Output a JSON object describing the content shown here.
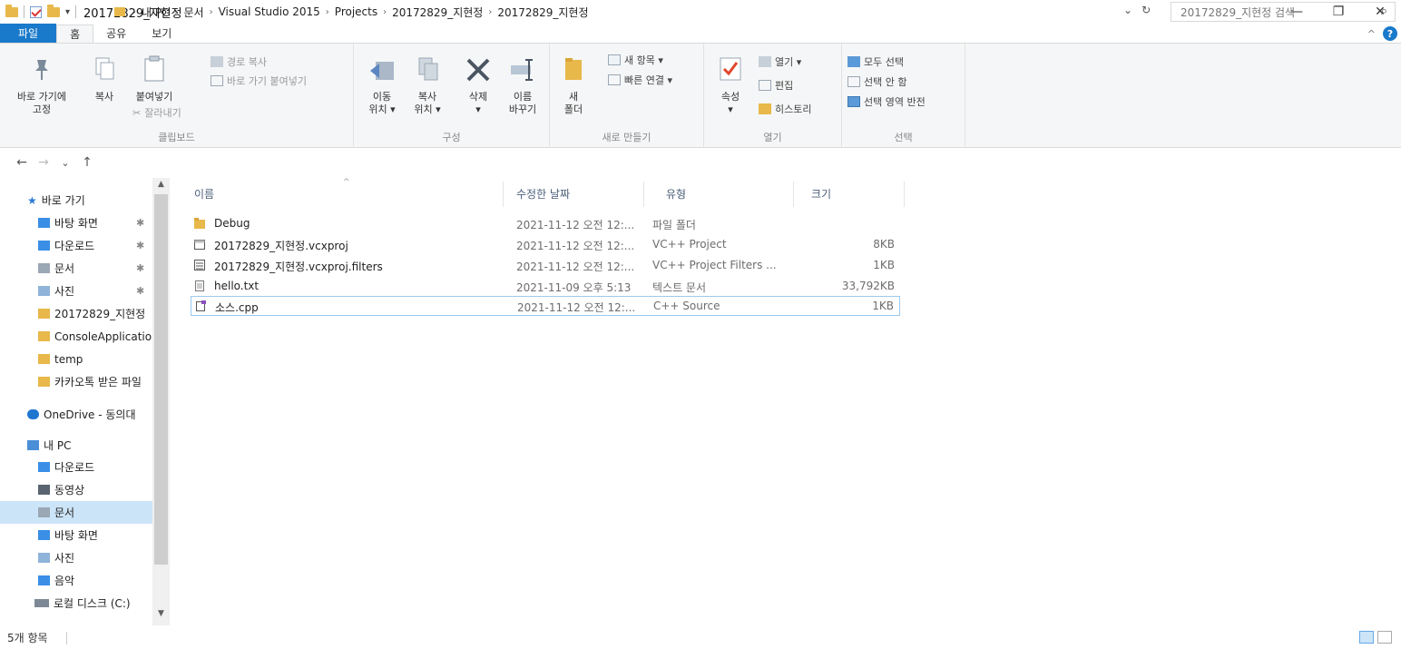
{
  "window": {
    "title": "20172829_지현정",
    "minimize": "—",
    "restore": "❐",
    "close": "✕"
  },
  "ribbon_tabs": {
    "file": "파일",
    "home": "홈",
    "share": "공유",
    "view": "보기",
    "collapse": "^",
    "help": "?"
  },
  "ribbon": {
    "clipboard": {
      "pin_label_1": "바로 가기에",
      "pin_label_2": "고정",
      "copy": "복사",
      "paste": "붙여넣기",
      "copy_path": "경로 복사",
      "paste_shortcut": "바로 가기 붙여넣기",
      "cut": "잘라내기",
      "group": "클립보드"
    },
    "organize": {
      "move_1": "이동",
      "move_2": "위치 ▾",
      "copyto_1": "복사",
      "copyto_2": "위치 ▾",
      "delete": "삭제",
      "delete_caret": "▾",
      "rename_1": "이름",
      "rename_2": "바꾸기",
      "group": "구성"
    },
    "new": {
      "new_folder_1": "새",
      "new_folder_2": "폴더",
      "new_item": "새 항목 ▾",
      "easy_access": "빠른 연결 ▾",
      "group": "새로 만들기"
    },
    "open": {
      "properties": "속성",
      "properties_caret": "▾",
      "open": "열기 ▾",
      "edit": "편집",
      "history": "히스토리",
      "group": "열기"
    },
    "select": {
      "select_all": "모두 선택",
      "select_none": "선택 안 함",
      "invert": "선택 영역 반전",
      "group": "선택"
    }
  },
  "address": {
    "back": "←",
    "forward": "→",
    "recent": "⌄",
    "up": "↑",
    "crumbs": [
      "내 PC",
      "문서",
      "Visual Studio 2015",
      "Projects",
      "20172829_지현정",
      "20172829_지현정"
    ],
    "sep": "›",
    "lead_sep": "›",
    "dropdown": "⌄",
    "refresh": "↻",
    "search_placeholder": "20172829_지현정 검색",
    "search_icon": "⌕"
  },
  "nav_pane": {
    "quick_access": "바로 가기",
    "pin": "✱",
    "items": [
      {
        "label": "바탕 화면",
        "pinned": true
      },
      {
        "label": "다운로드",
        "pinned": true
      },
      {
        "label": "문서",
        "pinned": true
      },
      {
        "label": "사진",
        "pinned": true
      },
      {
        "label": "20172829_지현정",
        "pinned": false
      },
      {
        "label": "ConsoleApplication",
        "pinned": false
      },
      {
        "label": "temp",
        "pinned": false
      },
      {
        "label": "카카오톡 받은 파일",
        "pinned": false
      }
    ],
    "onedrive": "OneDrive - 동의대",
    "this_pc": "내 PC",
    "pc_items": [
      "다운로드",
      "동영상",
      "문서",
      "바탕 화면",
      "사진",
      "음악",
      "로컬 디스크 (C:)"
    ],
    "selected_pc_item": "문서",
    "scroll_up": "▲",
    "scroll_down": "▼"
  },
  "file_list": {
    "sort_arrow": "^",
    "columns": {
      "name": "이름",
      "date": "수정한 날짜",
      "type": "유형",
      "size": "크기"
    },
    "rows": [
      {
        "name": "Debug",
        "date": "2021-11-12 오전 12:...",
        "type": "파일 폴더",
        "size": "",
        "icon": "folder-icon"
      },
      {
        "name": "20172829_지현정.vcxproj",
        "date": "2021-11-12 오전 12:...",
        "type": "VC++ Project",
        "size": "8KB",
        "icon": "vcxproj-icon"
      },
      {
        "name": "20172829_지현정.vcxproj.filters",
        "date": "2021-11-12 오전 12:...",
        "type": "VC++ Project Filters ...",
        "size": "1KB",
        "icon": "filters-icon"
      },
      {
        "name": "hello.txt",
        "date": "2021-11-09 오후 5:13",
        "type": "텍스트 문서",
        "size": "33,792KB",
        "icon": "text-file-icon"
      },
      {
        "name": "소스.cpp",
        "date": "2021-11-12 오전 12:...",
        "type": "C++ Source",
        "size": "1KB",
        "icon": "cpp-file-icon"
      }
    ]
  },
  "status": {
    "count": "5개 항목"
  },
  "colors": {
    "accent": "#1979ca",
    "folder": "#e8b84a",
    "selection": "#cce4f7"
  }
}
